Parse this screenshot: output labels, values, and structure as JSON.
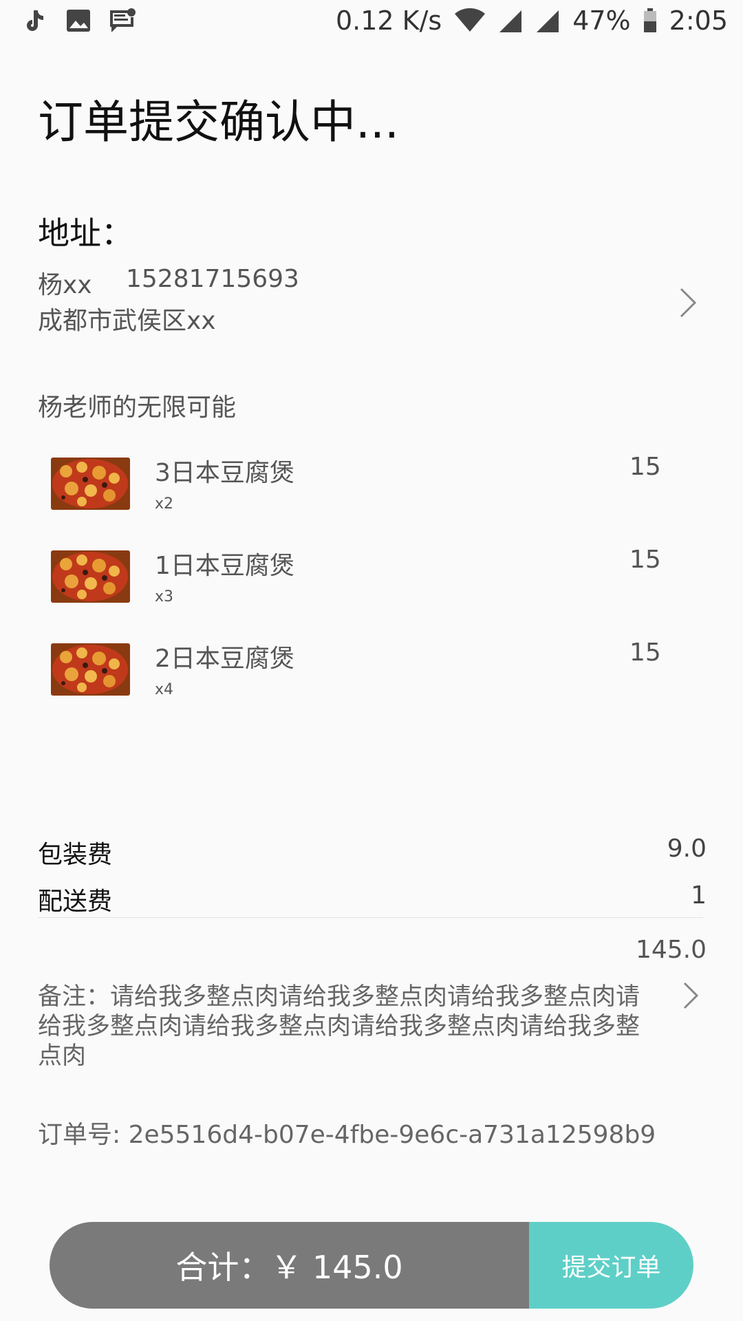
{
  "status_bar": {
    "net_speed": "0.12 K/s",
    "battery": "47%",
    "time": "2:05",
    "left_icons": [
      "tiktok-icon",
      "image-icon",
      "message-icon"
    ]
  },
  "title": "订单提交确认中...",
  "address": {
    "label": "地址：",
    "name": "杨xx",
    "phone": "15281715693",
    "line": "成都市武侯区xx"
  },
  "shop": {
    "name": "杨老师的无限可能"
  },
  "items": [
    {
      "name": "3日本豆腐煲",
      "qty": "x2",
      "price": "15"
    },
    {
      "name": "1日本豆腐煲",
      "qty": "x3",
      "price": "15"
    },
    {
      "name": "2日本豆腐煲",
      "qty": "x4",
      "price": "15"
    }
  ],
  "fees": {
    "packing_label": "包装费",
    "packing_value": "9.0",
    "delivery_label": "配送费",
    "delivery_value": "1",
    "subtotal": "145.0"
  },
  "note": "备注：请给我多整点肉请给我多整点肉请给我多整点肉请给我多整点肉请给我多整点肉请给我多整点肉请给我多整点肉",
  "order_no": "订单号: 2e5516d4-b07e-4fbe-9e6c-a731a12598b9",
  "footer": {
    "total": "合计：￥ 145.0",
    "submit_label": "提交订单"
  },
  "colors": {
    "total_bg": "#7a7a7a",
    "submit_bg": "#5ecfc7"
  }
}
